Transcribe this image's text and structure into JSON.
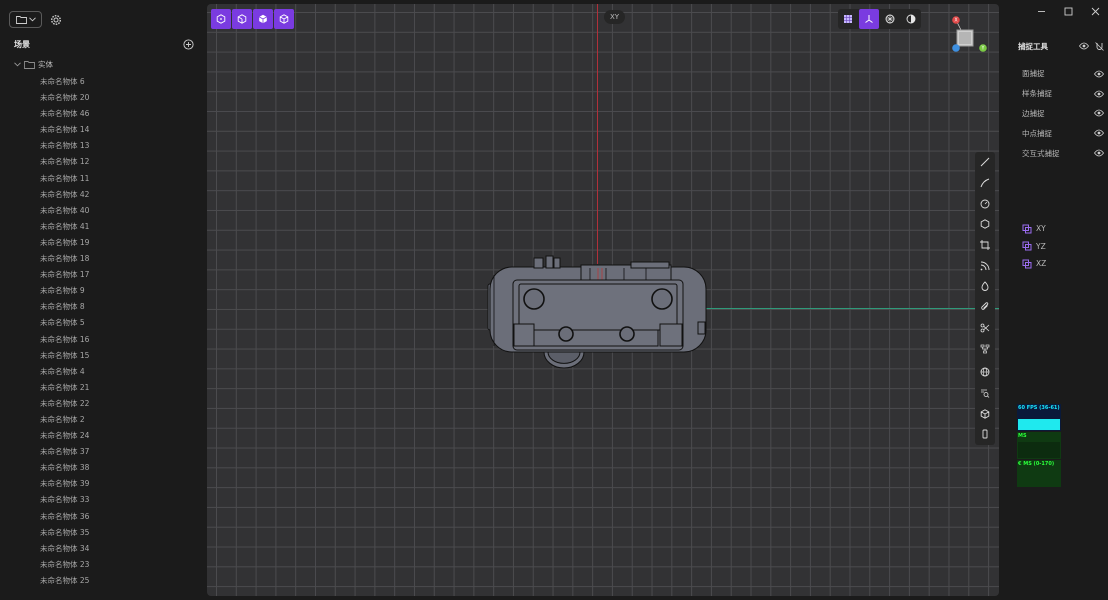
{
  "scene": {
    "title": "场景",
    "group": "实体",
    "objects": [
      "未命名物体 6",
      "未命名物体 20",
      "未命名物体 46",
      "未命名物体 14",
      "未命名物体 13",
      "未命名物体 12",
      "未命名物体 11",
      "未命名物体 42",
      "未命名物体 40",
      "未命名物体 41",
      "未命名物体 19",
      "未命名物体 18",
      "未命名物体 17",
      "未命名物体 9",
      "未命名物体 8",
      "未命名物体 5",
      "未命名物体 16",
      "未命名物体 15",
      "未命名物体 4",
      "未命名物体 21",
      "未命名物体 22",
      "未命名物体 2",
      "未命名物体 24",
      "未命名物体 37",
      "未命名物体 38",
      "未命名物体 39",
      "未命名物体 33",
      "未命名物体 36",
      "未命名物体 35",
      "未命名物体 34",
      "未命名物体 23",
      "未命名物体 25"
    ]
  },
  "viewport": {
    "plane_badge": "XY",
    "accent_color": "#7a3be0"
  },
  "snap": {
    "title": "捕捉工具",
    "items": [
      "面捕捉",
      "样条捕捉",
      "边捕捉",
      "中点捕捉",
      "交互式捕捉"
    ]
  },
  "planes": [
    "XY",
    "YZ",
    "XZ"
  ],
  "stats": {
    "fps": "60 FPS (36-61)",
    "ms": "MS",
    "mem": "€ MS (0-170)"
  }
}
